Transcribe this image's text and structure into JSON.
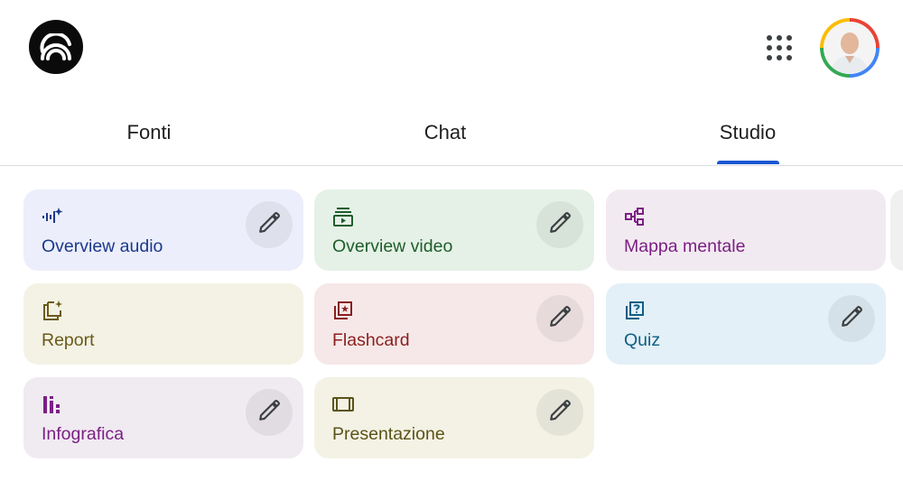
{
  "header": {
    "logo_icon": "notebook-logo-icon",
    "apps_icon": "apps-grid-icon",
    "avatar_icon": "user-avatar"
  },
  "tabs": [
    {
      "label": "Fonti",
      "active": false
    },
    {
      "label": "Chat",
      "active": false
    },
    {
      "label": "Studio",
      "active": true
    }
  ],
  "accent_color": "#1a57d1",
  "studio_cards": [
    {
      "label": "Overview audio",
      "icon": "audio-waveform-icon",
      "color": "#1a3a8a",
      "bg": "#eceefb",
      "has_edit": true
    },
    {
      "label": "Overview video",
      "icon": "video-stack-icon",
      "color": "#1d5e2c",
      "bg": "#e5f1e6",
      "has_edit": true
    },
    {
      "label": "Mappa mentale",
      "icon": "mind-map-icon",
      "color": "#7b1f84",
      "bg": "#f2eaf1",
      "has_edit": false
    },
    {
      "label": "Report",
      "icon": "report-sparkle-icon",
      "color": "#6b5a18",
      "bg": "#f3f2e5",
      "has_edit": false
    },
    {
      "label": "Flashcard",
      "icon": "flashcard-icon",
      "color": "#8a1f1f",
      "bg": "#f6e8e8",
      "has_edit": true
    },
    {
      "label": "Quiz",
      "icon": "quiz-icon",
      "color": "#0f5e85",
      "bg": "#e3f0f7",
      "has_edit": true
    },
    {
      "label": "Infografica",
      "icon": "infographic-icon",
      "color": "#7b1f84",
      "bg": "#f0eaf1",
      "has_edit": true
    },
    {
      "label": "Presentazione",
      "icon": "slides-icon",
      "color": "#5c5318",
      "bg": "#f3f2e5",
      "has_edit": true
    }
  ],
  "edit_icon": "pencil-icon"
}
